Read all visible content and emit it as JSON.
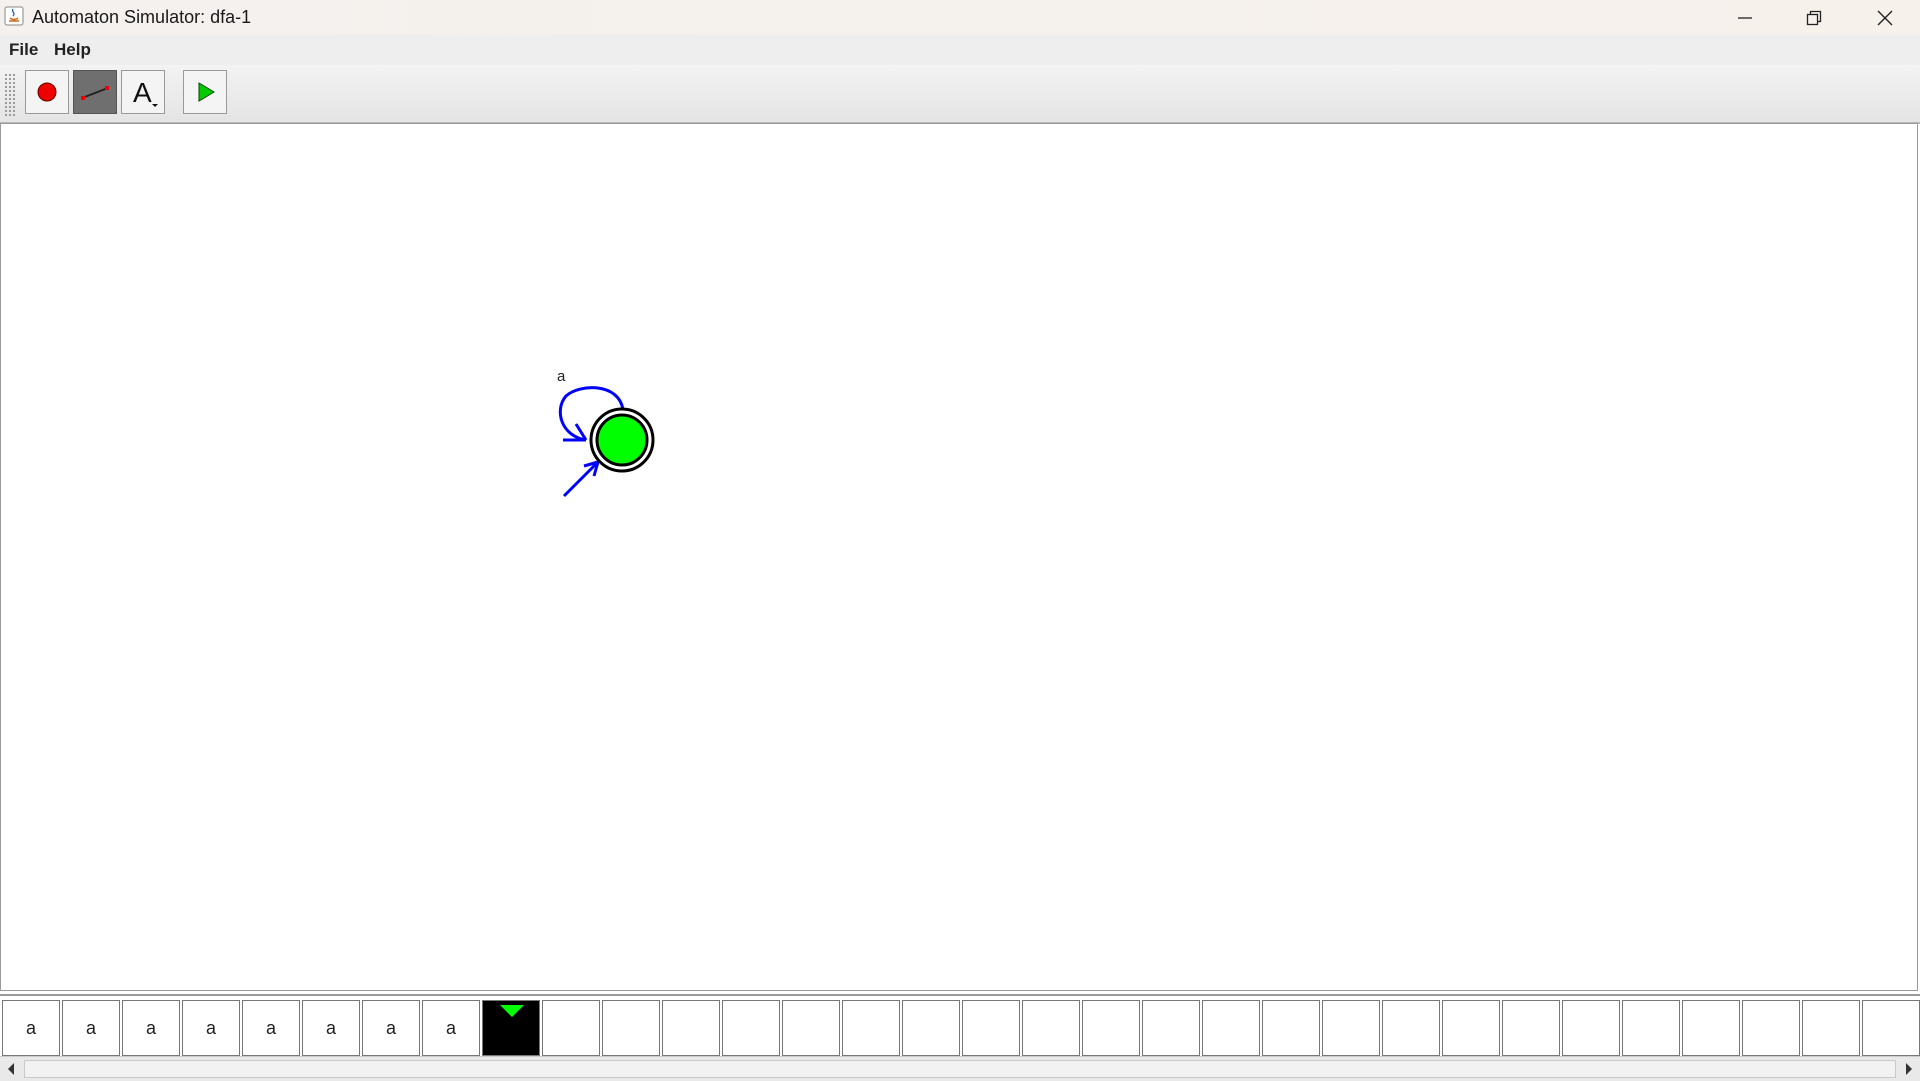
{
  "window": {
    "title": "Automaton Simulator: dfa-1"
  },
  "menu": {
    "items": [
      "File",
      "Help"
    ]
  },
  "toolbar": {
    "tools": [
      {
        "name": "add-state",
        "icon": "red-circle-icon"
      },
      {
        "name": "add-transition",
        "icon": "transition-line-icon",
        "selected": true
      },
      {
        "name": "edit-label",
        "icon": "text-A-icon"
      },
      {
        "name": "run",
        "icon": "green-play-icon"
      }
    ]
  },
  "automaton": {
    "states": [
      {
        "id": "q0",
        "initial": true,
        "accepting": true,
        "active": true
      }
    ],
    "transitions": [
      {
        "from": "q0",
        "to": "q0",
        "label": "a"
      }
    ]
  },
  "tape": {
    "symbols": [
      "a",
      "a",
      "a",
      "a",
      "a",
      "a",
      "a",
      "a",
      "",
      "",
      "",
      "",
      "",
      "",
      "",
      "",
      "",
      "",
      "",
      "",
      "",
      "",
      "",
      "",
      "",
      "",
      "",
      "",
      "",
      "",
      "",
      "",
      ""
    ],
    "head_index": 8
  },
  "colors": {
    "accept_fill": "#00ff00",
    "transition": "#0000ff",
    "head": "#00ff00"
  }
}
